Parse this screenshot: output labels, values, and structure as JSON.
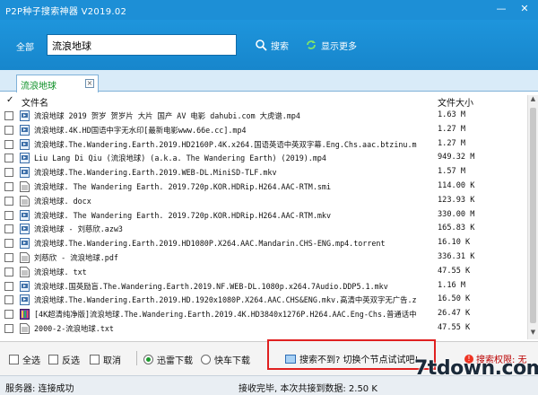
{
  "window": {
    "title": "P2P种子搜索神器 V2019.02",
    "minimize_glyph": "—",
    "close_glyph": "✕"
  },
  "header": {
    "scope_label": "全部",
    "search_value": "流浪地球",
    "search_button": "搜索",
    "show_more_button": "显示更多"
  },
  "tabs": [
    {
      "label": "流浪地球",
      "close_glyph": "×"
    }
  ],
  "table": {
    "check_header": "✓",
    "col_name": "文件名",
    "col_size": "文件大小",
    "rows": [
      {
        "icon": "video-file-icon",
        "name": "流浪地球 2019 贺岁 贺岁片 大片 国产 AV 电影 dahubi.com 大虎谱.mp4",
        "size": "1.63 M"
      },
      {
        "icon": "video-file-icon",
        "name": "流浪地球.4K.HD国语中字无水印[最新电影www.66e.cc].mp4",
        "size": "1.27 M"
      },
      {
        "icon": "video-file-icon",
        "name": "流浪地球.The.Wandering.Earth.2019.HD2160P.4K.x264.国语英语中英双字幕.Eng.Chs.aac.btzinu.m",
        "size": "1.27 M"
      },
      {
        "icon": "video-file-icon",
        "name": "Liu Lang Di Qiu (流浪地球) (a.k.a. The Wandering Earth) (2019).mp4",
        "size": "949.32 M"
      },
      {
        "icon": "video-file-icon",
        "name": "流浪地球.The.Wandering.Earth.2019.WEB-DL.MiniSD-TLF.mkv",
        "size": "1.57 M"
      },
      {
        "icon": "text-file-icon",
        "name": " 流浪地球. The Wandering Earth. 2019.720p.KOR.HDRip.H264.AAC-RTM.smi",
        "size": "114.00 K"
      },
      {
        "icon": "text-file-icon",
        "name": " 流浪地球. docx",
        "size": "123.93 K"
      },
      {
        "icon": "video-file-icon",
        "name": " 流浪地球. The Wandering Earth. 2019.720p.KOR.HDRip.H264.AAC-RTM.mkv",
        "size": "330.00 M"
      },
      {
        "icon": "video-file-icon",
        "name": " 流浪地球 - 刘慈欣.azw3",
        "size": "165.83 K"
      },
      {
        "icon": "video-file-icon",
        "name": "流浪地球.The.Wandering.Earth.2019.HD1080P.X264.AAC.Mandarin.CHS-ENG.mp4.torrent",
        "size": "16.10 K"
      },
      {
        "icon": "text-file-icon",
        "name": "刘慈欣 - 流浪地球.pdf",
        "size": "336.31 K"
      },
      {
        "icon": "text-file-icon",
        "name": "流浪地球. txt",
        "size": "47.55 K"
      },
      {
        "icon": "video-file-icon",
        "name": "流浪地球.国英励盲.The.Wandering.Earth.2019.NF.WEB-DL.1080p.x264.7Audio.DDP5.1.mkv",
        "size": "1.16 M"
      },
      {
        "icon": "video-file-icon",
        "name": "流浪地球.The.Wandering.Earth.2019.HD.1920x1080P.X264.AAC.CHS&ENG.mkv.高清中英双字无广告.z",
        "size": "16.50 K"
      },
      {
        "icon": "book-file-icon",
        "name": "[4K超清纯净版]流浪地球.The.Wandering.Earth.2019.4K.HD3840x1276P.H264.AAC.Eng-Chs.普通话中",
        "size": "26.47 K"
      },
      {
        "icon": "text-file-icon",
        "name": "2000-2-流浪地球.txt",
        "size": "47.55 K"
      }
    ]
  },
  "bottom": {
    "select_all": "全选",
    "invert": "反选",
    "cancel": "取消",
    "thunder_download": "迅雷下载",
    "express_download": "快车下载",
    "hint": "搜索不到? 切换个节点试试吧!",
    "right_tip": "搜索权限: 无"
  },
  "status": {
    "server": "服务器: 连接成功",
    "progress": "接收完毕, 本次共接到数据: 2.50 K"
  },
  "watermark": "7tdown.com",
  "colors": {
    "titlebar": "#1d8fd6",
    "tab_text": "#0a8f24",
    "hint_border": "#e02020"
  }
}
